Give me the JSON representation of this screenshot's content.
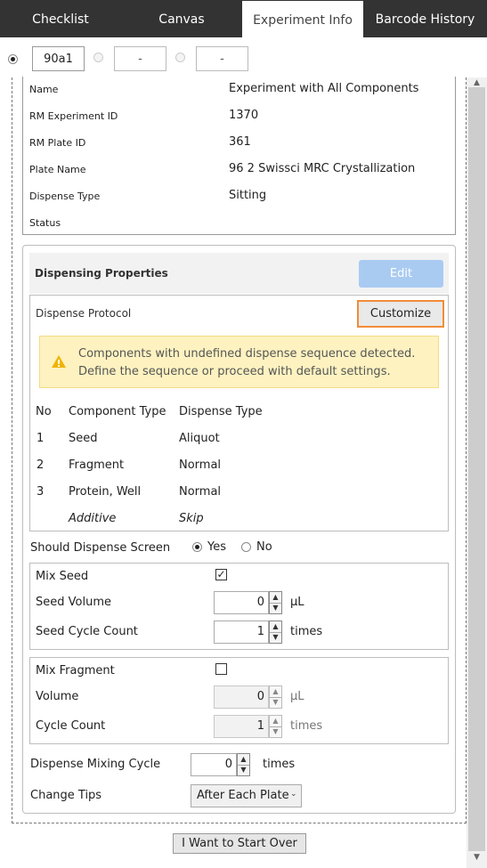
{
  "tabs": [
    {
      "label": "Checklist"
    },
    {
      "label": "Canvas"
    },
    {
      "label": "Experiment Info"
    },
    {
      "label": "Barcode History"
    }
  ],
  "plates": [
    {
      "value": "90a1",
      "selected": true
    },
    {
      "value": "-",
      "selected": false
    },
    {
      "value": "-",
      "selected": false
    }
  ],
  "info": {
    "rows": [
      {
        "label": "Name",
        "value": "Experiment with All Components"
      },
      {
        "label": "RM Experiment ID",
        "value": "1370"
      },
      {
        "label": "RM Plate ID",
        "value": "361"
      },
      {
        "label": "Plate Name",
        "value": "96 2 Swissci MRC Crystallization"
      },
      {
        "label": "Dispense Type",
        "value": "Sitting"
      },
      {
        "label": "Status",
        "value": ""
      }
    ]
  },
  "dispensing": {
    "title": "Dispensing Properties",
    "edit_label": "Edit",
    "protocol_label": "Dispense Protocol",
    "customize_label": "Customize",
    "warning_line1": "Components with undefined dispense sequence detected.",
    "warning_line2": "Define the sequence or proceed with default settings.",
    "table": {
      "headers": [
        "No",
        "Component Type",
        "Dispense Type"
      ],
      "rows": [
        {
          "no": "1",
          "component": "Seed",
          "dispense": "Aliquot"
        },
        {
          "no": "2",
          "component": "Fragment",
          "dispense": "Normal"
        },
        {
          "no": "3",
          "component": "Protein, Well",
          "dispense": "Normal"
        },
        {
          "no": "",
          "component": "Additive",
          "dispense": "Skip"
        }
      ]
    },
    "screen_label": "Should Dispense Screen",
    "yes_label": "Yes",
    "no_label": "No",
    "mix_seed": {
      "label": "Mix Seed",
      "checked": true,
      "volume_label": "Seed Volume",
      "volume_value": "0",
      "volume_unit": "µL",
      "cycle_label": "Seed Cycle Count",
      "cycle_value": "1",
      "cycle_unit": "times"
    },
    "mix_fragment": {
      "label": "Mix Fragment",
      "checked": false,
      "volume_label": "Volume",
      "volume_value": "0",
      "volume_unit": "µL",
      "cycle_label": "Cycle Count",
      "cycle_value": "1",
      "cycle_unit": "times"
    },
    "mixing_cycle_label": "Dispense Mixing Cycle",
    "mixing_cycle_value": "0",
    "mixing_cycle_unit": "times",
    "change_tips_label": "Change Tips",
    "change_tips_value": "After Each Plate"
  },
  "start_over_label": "I Want to Start Over",
  "colors": {
    "tabbar": "#333333",
    "edit_button": "#a9cbf2",
    "customize_border": "#f28c38",
    "warning_bg": "#fdf2c0",
    "warning_icon": "#f0b400"
  }
}
